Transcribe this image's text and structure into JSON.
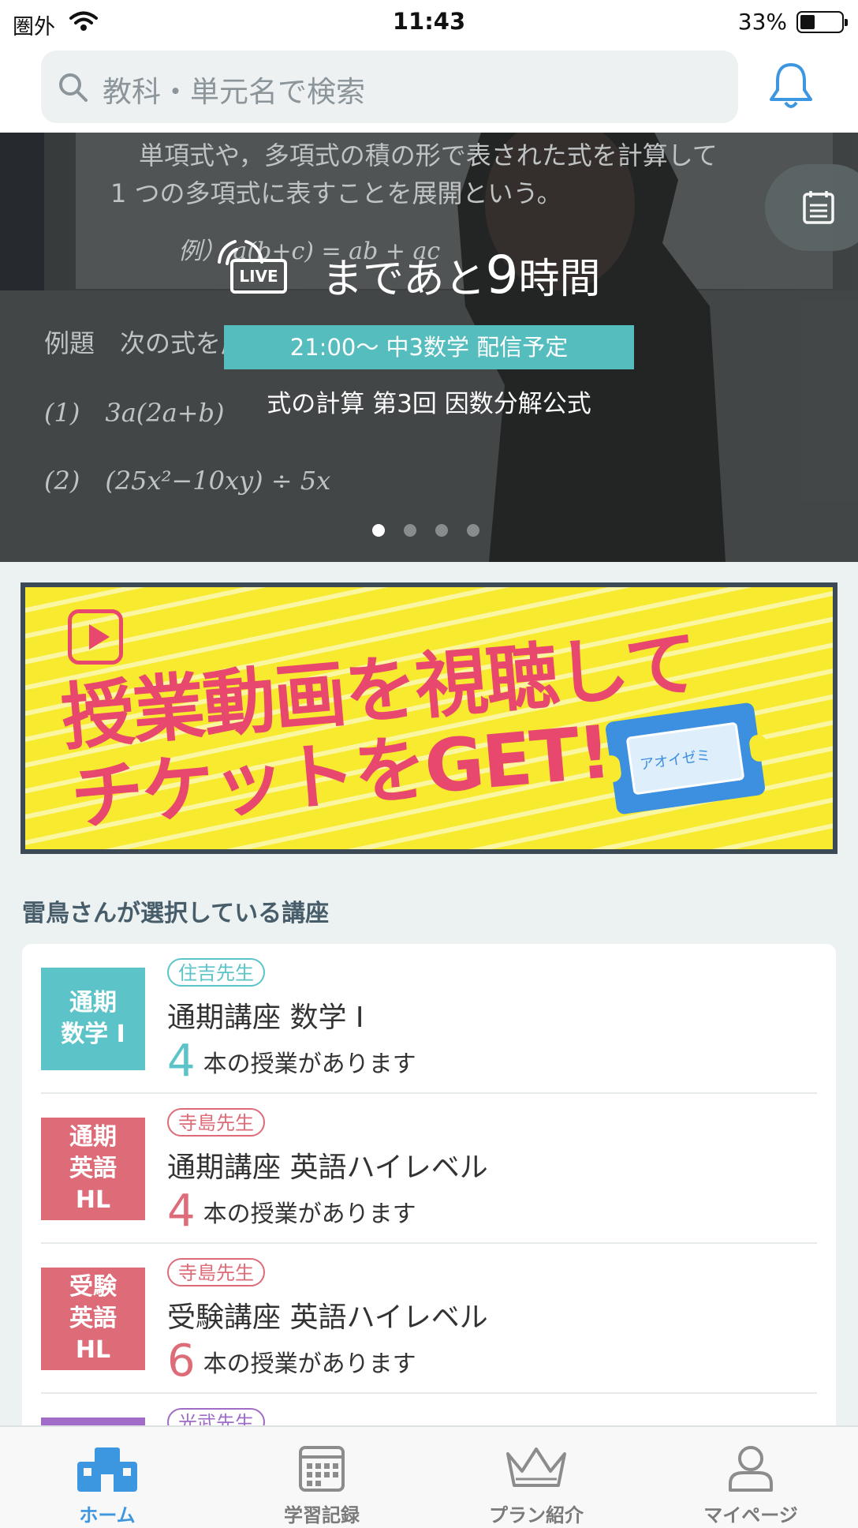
{
  "status_bar": {
    "carrier": "圏外",
    "time": "11:43",
    "battery": "33%"
  },
  "search": {
    "placeholder": "教科・単元名で検索"
  },
  "hero": {
    "live_badge": "LIVE",
    "countdown_prefix": "まであと",
    "countdown_value": "9",
    "countdown_unit": "時間",
    "schedule": "21:00〜 中3数学 配信予定",
    "title": "式の計算 第3回 因数分解公式",
    "board_lines": [
      "単項式や，多項式の積の形で表された式を計算して",
      "1 つの多項式に表すことを展開という。",
      "例） a(b+c) = ab + ac",
      "例題　次の式を展開しなさい。",
      "(1)　3a(2a+b)",
      "(2)　(25x²−10xy) ÷ 5x"
    ],
    "slide_count": 4,
    "active_slide": 1
  },
  "banner": {
    "line1": "授業動画を視聴して",
    "line2": "チケットをGET!",
    "ticket_brand": "アオイゼミ"
  },
  "section_title": "雷鳥さんが選択している講座",
  "courses": [
    {
      "badge": "通期\n数学 I",
      "teacher": "住吉先生",
      "name": "通期講座 数学 I",
      "count": "4",
      "suffix": "本の授業があります",
      "color": "#5cc4c8"
    },
    {
      "badge": "通期\n英語\nHL",
      "teacher": "寺島先生",
      "name": "通期講座 英語ハイレベル",
      "count": "4",
      "suffix": "本の授業があります",
      "color": "#dd6c78"
    },
    {
      "badge": "受験\n英語\nHL",
      "teacher": "寺島先生",
      "name": "受験講座 英語ハイレベル",
      "count": "6",
      "suffix": "本の授業があります",
      "color": "#dd6c78"
    },
    {
      "badge": "",
      "teacher": "光武先生",
      "name": "",
      "count": "",
      "suffix": "",
      "color": "#a06cc8"
    }
  ],
  "tabs": [
    {
      "label": "ホーム",
      "icon": "home-icon",
      "active": true
    },
    {
      "label": "学習記録",
      "icon": "calendar-icon",
      "active": false
    },
    {
      "label": "プラン紹介",
      "icon": "crown-icon",
      "active": false
    },
    {
      "label": "マイページ",
      "icon": "person-icon",
      "active": false
    }
  ],
  "colors": {
    "accent_blue": "#3d96e0",
    "teal": "#5cc4c8",
    "pink": "#dd6c78",
    "purple": "#a06cc8",
    "banner_yellow": "#f8ea2e",
    "banner_pink": "#e8476e"
  }
}
